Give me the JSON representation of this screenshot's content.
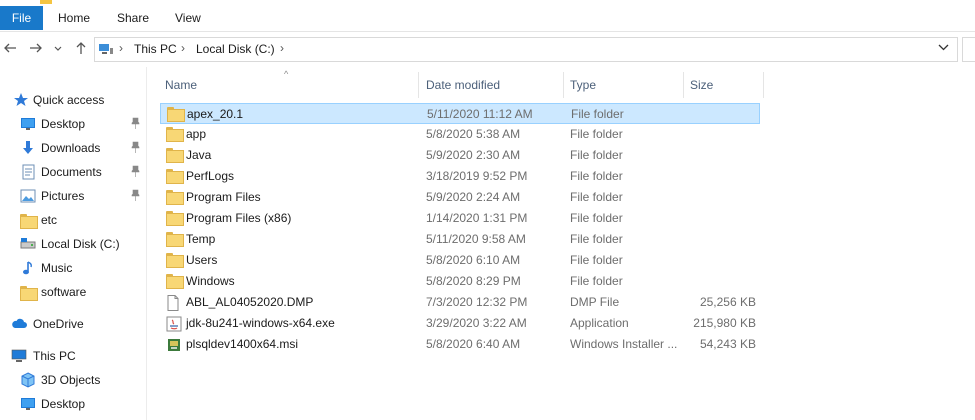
{
  "ribbon": {
    "tabs": [
      {
        "label": "File",
        "active": true
      },
      {
        "label": "Home"
      },
      {
        "label": "Share"
      },
      {
        "label": "View"
      }
    ],
    "accent": "#1979ca"
  },
  "address": {
    "breadcrumbs": [
      "This PC",
      "Local Disk (C:)"
    ]
  },
  "navpane": {
    "items": [
      {
        "label": "Quick access",
        "icon": "star-icon"
      },
      {
        "label": "Desktop",
        "icon": "desktop-icon",
        "pinned": true
      },
      {
        "label": "Downloads",
        "icon": "download-icon",
        "pinned": true
      },
      {
        "label": "Documents",
        "icon": "documents-icon",
        "pinned": true
      },
      {
        "label": "Pictures",
        "icon": "pictures-icon",
        "pinned": true
      },
      {
        "label": "etc",
        "icon": "folder-icon"
      },
      {
        "label": "Local Disk (C:)",
        "icon": "drive-icon"
      },
      {
        "label": "Music",
        "icon": "music-icon"
      },
      {
        "label": "software",
        "icon": "folder-icon"
      },
      {
        "label": "OneDrive",
        "icon": "cloud-icon"
      },
      {
        "label": "This PC",
        "icon": "computer-icon"
      },
      {
        "label": "3D Objects",
        "icon": "3d-objects-icon"
      },
      {
        "label": "Desktop",
        "icon": "desktop-icon"
      }
    ]
  },
  "columns": {
    "name": "Name",
    "date": "Date modified",
    "type": "Type",
    "size": "Size"
  },
  "files": [
    {
      "name": "apex_20.1",
      "date": "5/11/2020 11:12 AM",
      "type": "File folder",
      "size": "",
      "icon": "folder-icon",
      "selected": true
    },
    {
      "name": "app",
      "date": "5/8/2020 5:38 AM",
      "type": "File folder",
      "size": "",
      "icon": "folder-icon"
    },
    {
      "name": "Java",
      "date": "5/9/2020 2:30 AM",
      "type": "File folder",
      "size": "",
      "icon": "folder-icon"
    },
    {
      "name": "PerfLogs",
      "date": "3/18/2019 9:52 PM",
      "type": "File folder",
      "size": "",
      "icon": "folder-icon"
    },
    {
      "name": "Program Files",
      "date": "5/9/2020 2:24 AM",
      "type": "File folder",
      "size": "",
      "icon": "folder-icon"
    },
    {
      "name": "Program Files (x86)",
      "date": "1/14/2020 1:31 PM",
      "type": "File folder",
      "size": "",
      "icon": "folder-icon"
    },
    {
      "name": "Temp",
      "date": "5/11/2020 9:58 AM",
      "type": "File folder",
      "size": "",
      "icon": "folder-icon"
    },
    {
      "name": "Users",
      "date": "5/8/2020 6:10 AM",
      "type": "File folder",
      "size": "",
      "icon": "folder-icon"
    },
    {
      "name": "Windows",
      "date": "5/8/2020 8:29 PM",
      "type": "File folder",
      "size": "",
      "icon": "folder-icon"
    },
    {
      "name": "ABL_AL04052020.DMP",
      "date": "7/3/2020 12:32 PM",
      "type": "DMP File",
      "size": "25,256 KB",
      "icon": "file-icon"
    },
    {
      "name": "jdk-8u241-windows-x64.exe",
      "date": "3/29/2020 3:22 AM",
      "type": "Application",
      "size": "215,980 KB",
      "icon": "java-installer-icon"
    },
    {
      "name": "plsqldev1400x64.msi",
      "date": "5/8/2020 6:40 AM",
      "type": "Windows Installer ...",
      "size": "54,243 KB",
      "icon": "msi-installer-icon"
    }
  ]
}
